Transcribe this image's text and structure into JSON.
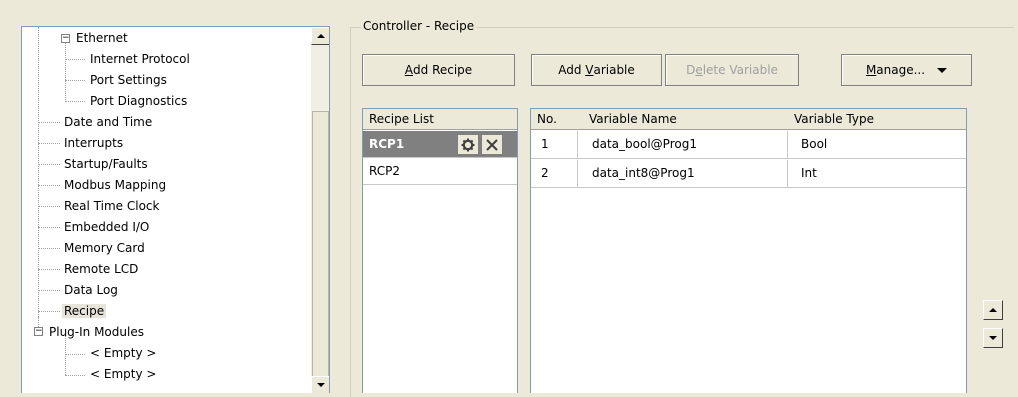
{
  "tree": {
    "items": [
      {
        "label": "Ethernet"
      },
      {
        "label": "Internet Protocol"
      },
      {
        "label": "Port Settings"
      },
      {
        "label": "Port Diagnostics"
      },
      {
        "label": "Date and Time"
      },
      {
        "label": "Interrupts"
      },
      {
        "label": "Startup/Faults"
      },
      {
        "label": "Modbus Mapping"
      },
      {
        "label": "Real Time Clock"
      },
      {
        "label": "Embedded I/O"
      },
      {
        "label": "Memory Card"
      },
      {
        "label": "Remote LCD"
      },
      {
        "label": "Data Log"
      },
      {
        "label": "Recipe"
      },
      {
        "label": "Plug-In Modules"
      },
      {
        "label": "< Empty >"
      },
      {
        "label": "< Empty >"
      }
    ],
    "expand_glyph": "−"
  },
  "group": {
    "title": "Controller - Recipe"
  },
  "toolbar": {
    "add_recipe": {
      "pre": "",
      "key": "A",
      "post": "dd Recipe"
    },
    "add_variable": {
      "pre": "Add ",
      "key": "V",
      "post": "ariable"
    },
    "delete_variable": {
      "pre": "D",
      "key": "e",
      "post": "lete Variable"
    },
    "manage": {
      "pre": "",
      "key": "M",
      "post": "anage..."
    }
  },
  "recipe_list": {
    "header": "Recipe List",
    "items": [
      {
        "name": "RCP1",
        "selected": true
      },
      {
        "name": "RCP2",
        "selected": false
      }
    ],
    "settings_icon": "gear-icon",
    "delete_icon": "close-icon"
  },
  "variables": {
    "columns": [
      "No.",
      "Variable Name",
      "Variable Type"
    ],
    "rows": [
      {
        "no": "1",
        "name": "data_bool@Prog1",
        "type": "Bool"
      },
      {
        "no": "2",
        "name": "data_int8@Prog1",
        "type": "Int"
      }
    ]
  },
  "colors": {
    "window_bg": "#ece9d8",
    "selected_recipe_bg": "#808080",
    "border_blue": "#7f9db9"
  }
}
